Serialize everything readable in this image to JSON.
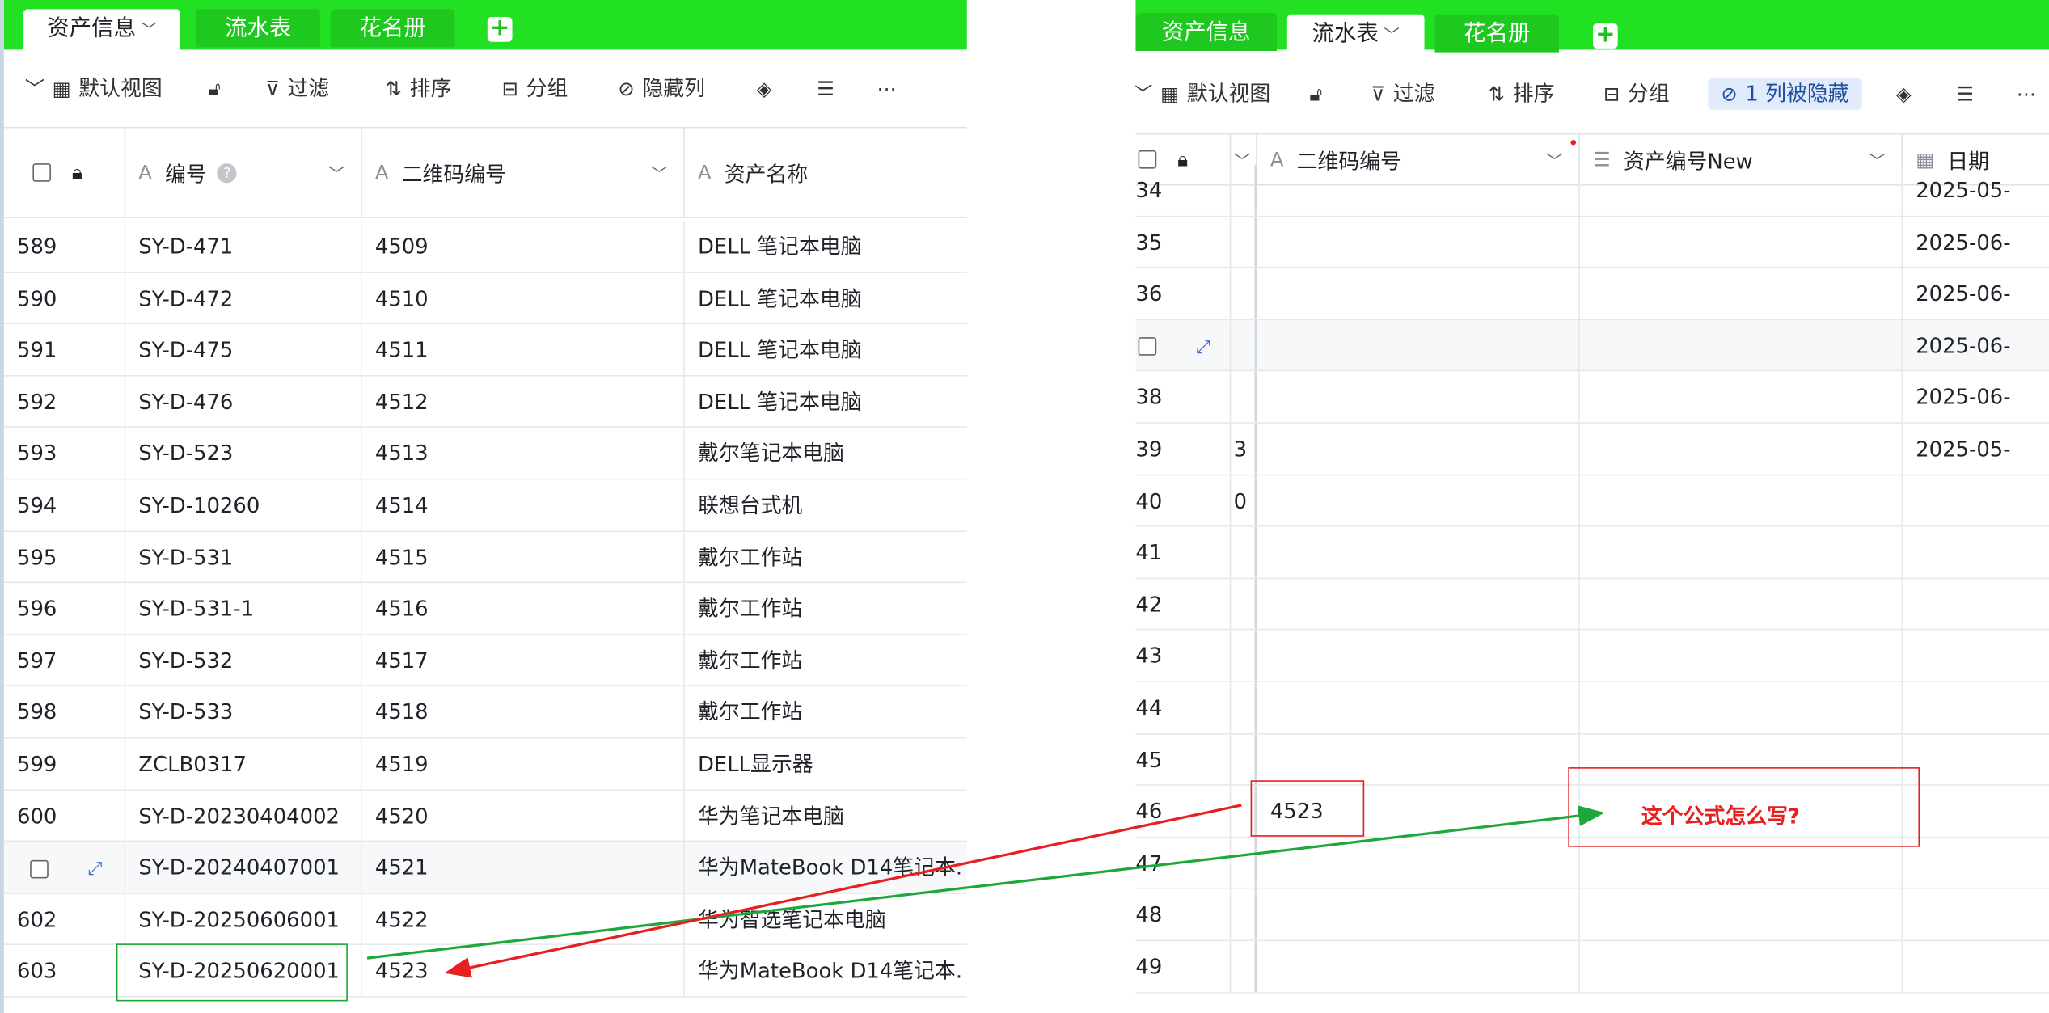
{
  "left": {
    "tabs": [
      {
        "label": "资产信息",
        "active": true
      },
      {
        "label": "流水表",
        "active": false
      },
      {
        "label": "花名册",
        "active": false
      }
    ],
    "toolbar": {
      "view": "默认视图",
      "filter": "过滤",
      "sort": "排序",
      "group": "分组",
      "hide": "隐藏列"
    },
    "columns": [
      "编号",
      "二维码编号",
      "资产名称"
    ],
    "rows": [
      {
        "n": "589",
        "code": "SY-D-471",
        "qr": "4509",
        "name": "DELL 笔记本电脑"
      },
      {
        "n": "590",
        "code": "SY-D-472",
        "qr": "4510",
        "name": "DELL 笔记本电脑"
      },
      {
        "n": "591",
        "code": "SY-D-475",
        "qr": "4511",
        "name": "DELL 笔记本电脑"
      },
      {
        "n": "592",
        "code": "SY-D-476",
        "qr": "4512",
        "name": "DELL 笔记本电脑"
      },
      {
        "n": "593",
        "code": "SY-D-523",
        "qr": "4513",
        "name": "戴尔笔记本电脑"
      },
      {
        "n": "594",
        "code": "SY-D-10260",
        "qr": "4514",
        "name": "联想台式机"
      },
      {
        "n": "595",
        "code": "SY-D-531",
        "qr": "4515",
        "name": "戴尔工作站"
      },
      {
        "n": "596",
        "code": "SY-D-531-1",
        "qr": "4516",
        "name": "戴尔工作站"
      },
      {
        "n": "597",
        "code": "SY-D-532",
        "qr": "4517",
        "name": "戴尔工作站"
      },
      {
        "n": "598",
        "code": "SY-D-533",
        "qr": "4518",
        "name": "戴尔工作站"
      },
      {
        "n": "599",
        "code": "ZCLB0317",
        "qr": "4519",
        "name": "DELL显示器"
      },
      {
        "n": "600",
        "code": "SY-D-20230404002",
        "qr": "4520",
        "name": "华为笔记本电脑"
      },
      {
        "n": "",
        "code": "SY-D-20240407001",
        "qr": "4521",
        "name": "华为MateBook D14笔记本."
      },
      {
        "n": "602",
        "code": "SY-D-20250606001",
        "qr": "4522",
        "name": "华为智选笔记本电脑"
      },
      {
        "n": "603",
        "code": "SY-D-20250620001",
        "qr": "4523",
        "name": "华为MateBook D14笔记本."
      }
    ]
  },
  "right": {
    "tabs": [
      {
        "label": "资产信息",
        "active": false
      },
      {
        "label": "流水表",
        "active": true
      },
      {
        "label": "花名册",
        "active": false
      }
    ],
    "toolbar": {
      "view": "默认视图",
      "filter": "过滤",
      "sort": "排序",
      "group": "分组",
      "hidden": "1 列被隐藏"
    },
    "columns": [
      "二维码编号",
      "资产编号New",
      "日期"
    ],
    "rows": [
      {
        "n": "34",
        "c0": "",
        "qr": "",
        "date": "2025-05-"
      },
      {
        "n": "35",
        "c0": "",
        "qr": "",
        "date": "2025-06-"
      },
      {
        "n": "36",
        "c0": "",
        "qr": "",
        "date": "2025-06-"
      },
      {
        "n": "",
        "c0": "",
        "qr": "",
        "date": "2025-06-"
      },
      {
        "n": "38",
        "c0": "",
        "qr": "",
        "date": "2025-06-"
      },
      {
        "n": "39",
        "c0": "3",
        "qr": "",
        "date": "2025-05-"
      },
      {
        "n": "40",
        "c0": "0",
        "qr": "",
        "date": ""
      },
      {
        "n": "41",
        "c0": "",
        "qr": "",
        "date": ""
      },
      {
        "n": "42",
        "c0": "",
        "qr": "",
        "date": ""
      },
      {
        "n": "43",
        "c0": "",
        "qr": "",
        "date": ""
      },
      {
        "n": "44",
        "c0": "",
        "qr": "",
        "date": ""
      },
      {
        "n": "45",
        "c0": "",
        "qr": "",
        "date": ""
      },
      {
        "n": "46",
        "c0": "",
        "qr": "4523",
        "date": ""
      },
      {
        "n": "47",
        "c0": "",
        "qr": "",
        "date": ""
      },
      {
        "n": "48",
        "c0": "",
        "qr": "",
        "date": ""
      },
      {
        "n": "49",
        "c0": "",
        "qr": "",
        "date": ""
      }
    ]
  },
  "annotation": {
    "question": "这个公式怎么写?",
    "green": "#1fa83a",
    "red": "#e62020"
  }
}
